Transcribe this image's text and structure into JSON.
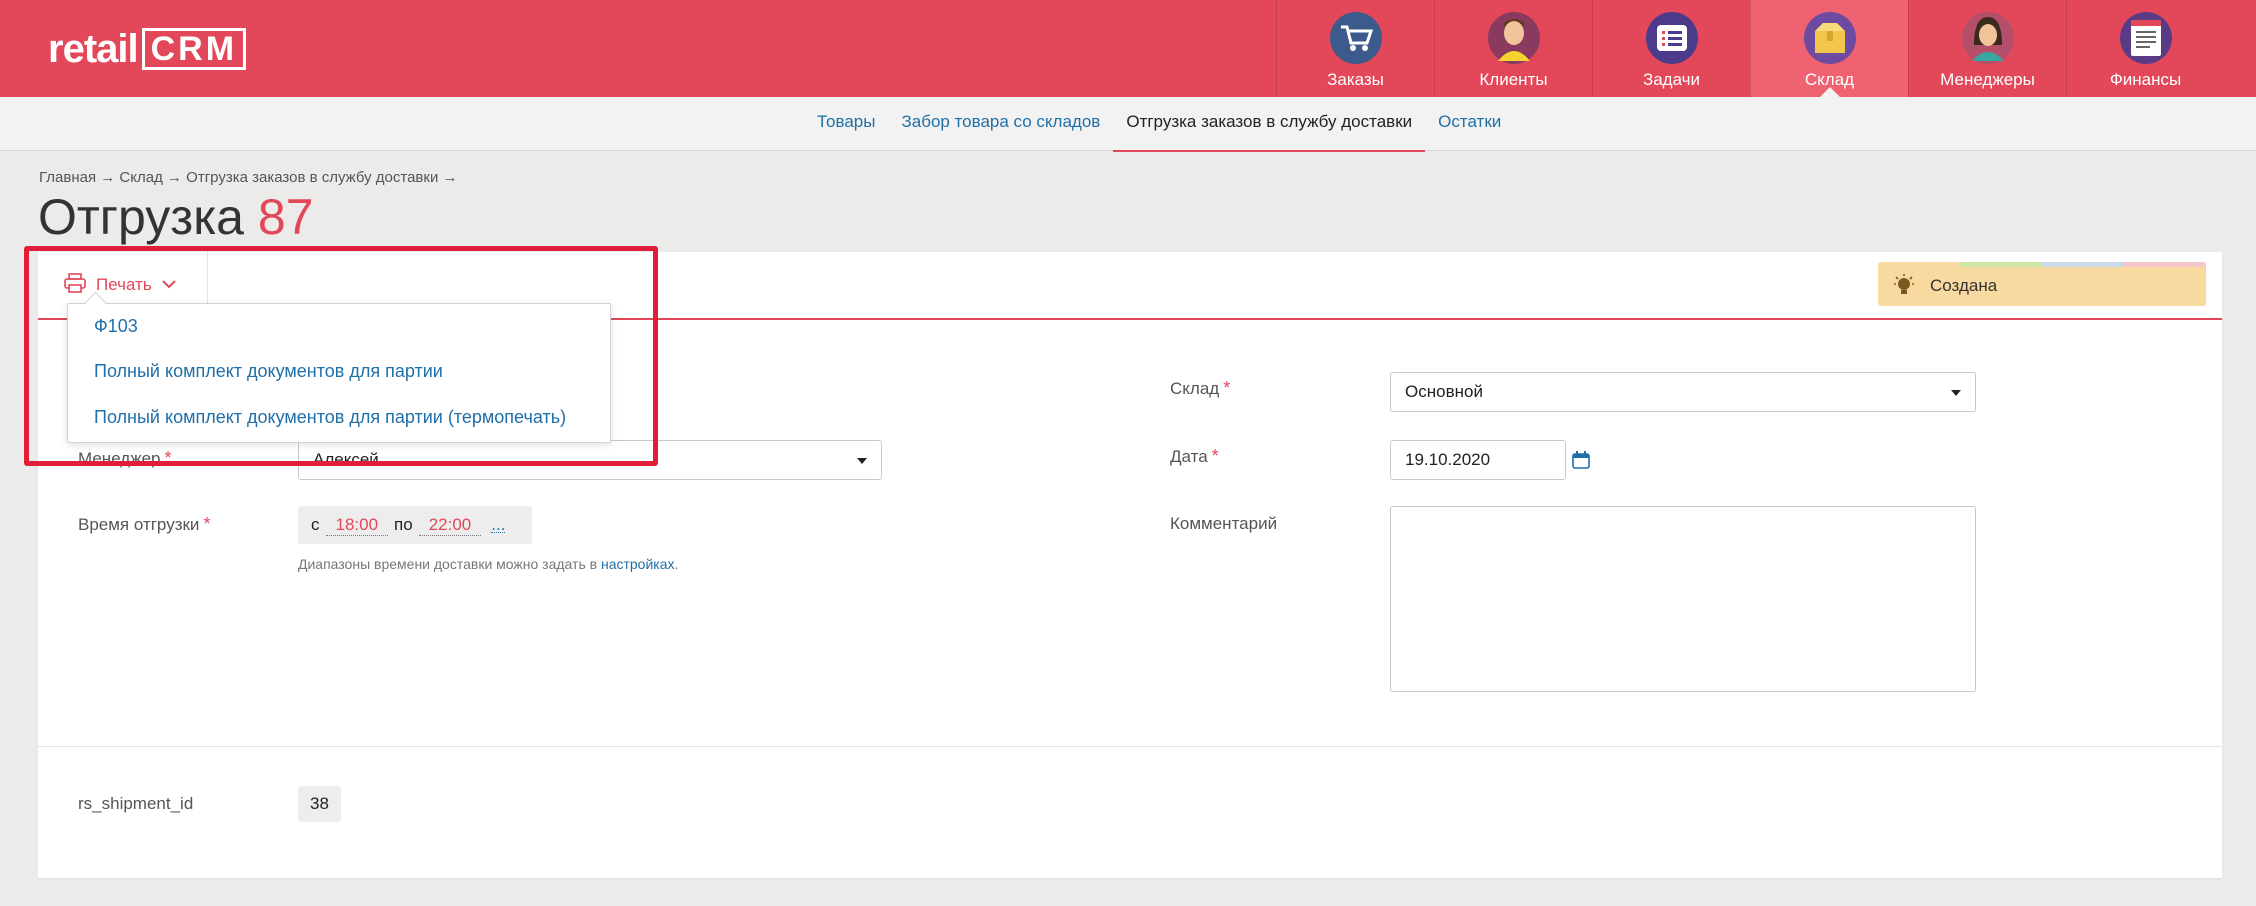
{
  "header": {
    "logo_retail": "retail",
    "logo_crm": "CRM",
    "nav": [
      {
        "label": "Заказы",
        "icon": "cart-icon"
      },
      {
        "label": "Клиенты",
        "icon": "client-avatar-icon"
      },
      {
        "label": "Задачи",
        "icon": "tasks-list-icon"
      },
      {
        "label": "Склад",
        "icon": "warehouse-box-icon"
      },
      {
        "label": "Менеджеры",
        "icon": "manager-avatar-icon"
      },
      {
        "label": "Финансы",
        "icon": "finance-document-icon"
      }
    ],
    "active_nav": "Склад"
  },
  "subnav": {
    "items": [
      "Товары",
      "Забор товара со складов",
      "Отгрузка заказов в службу доставки",
      "Остатки"
    ],
    "active": "Отгрузка заказов в службу доставки"
  },
  "breadcrumb": "Главная → Склад → Отгрузка заказов в службу доставки →",
  "title": {
    "text": "Отгрузка",
    "number": "87"
  },
  "toolbar": {
    "print_label": "Печать",
    "status_label": "Создана"
  },
  "print_menu": {
    "items": [
      "Ф103",
      "Полный комплект документов для партии",
      "Полный комплект документов для партии (термопечать)"
    ]
  },
  "form": {
    "manager_label": "Менеджер",
    "manager_value": "Алексей",
    "time_label": "Время отгрузки",
    "time_from_prefix": "с",
    "time_from": "18:00",
    "time_to_prefix": "по",
    "time_to": "22:00",
    "time_more": "...",
    "hint_text": "Диапазоны времени доставки можно задать в ",
    "hint_link": "настройках",
    "hint_end": ".",
    "warehouse_label": "Склад",
    "warehouse_value": "Основной",
    "date_label": "Дата",
    "date_value": "19.10.2020",
    "comment_label": "Комментарий",
    "comment_value": "",
    "custom_field_label": "rs_shipment_id",
    "custom_field_value": "38"
  },
  "colors": {
    "brand": "#e2485a",
    "link": "#1f6fa8",
    "status_bg": "#f8d9a0",
    "highlight": "#e01e37"
  }
}
